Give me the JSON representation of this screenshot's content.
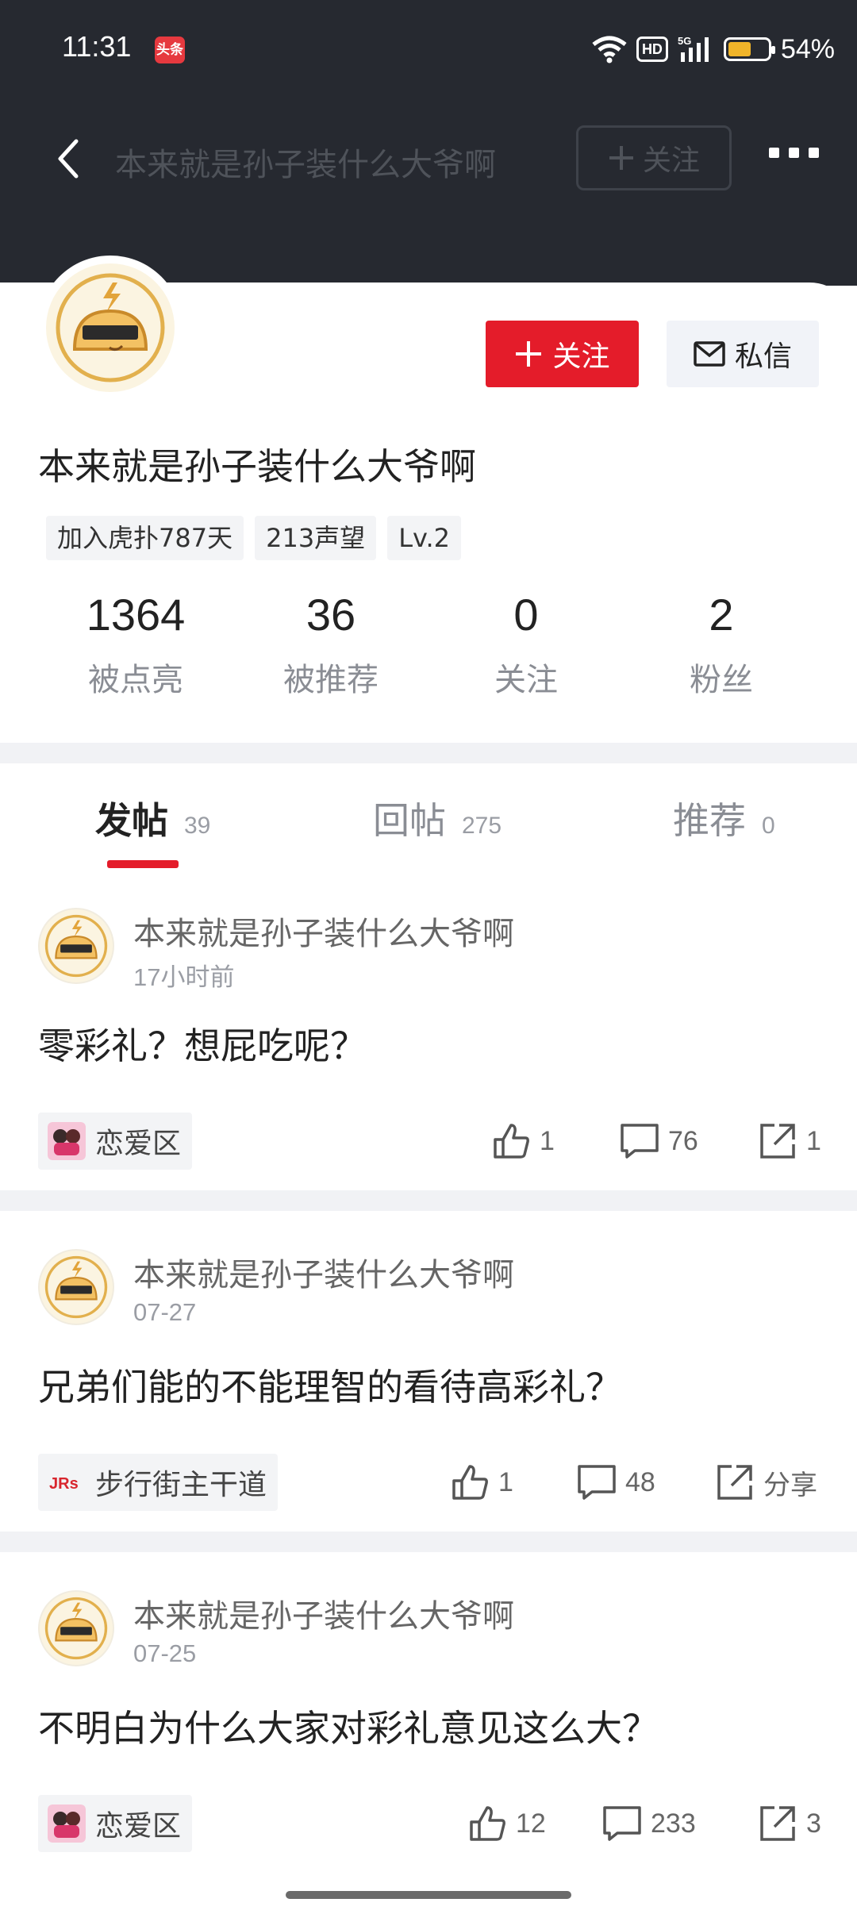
{
  "status_bar": {
    "time": "11:31",
    "app_badge": "头条",
    "network": "5G",
    "hd": "HD",
    "battery": "54%"
  },
  "nav": {
    "title": "本来就是孙子装什么大爷啊",
    "follow_label": "关注"
  },
  "profile": {
    "name": "本来就是孙子装什么大爷啊",
    "follow_button": "关注",
    "message_button": "私信",
    "tags": [
      "加入虎扑787天",
      "213声望",
      "Lv.2"
    ],
    "stats": [
      {
        "value": "1364",
        "label": "被点亮"
      },
      {
        "value": "36",
        "label": "被推荐"
      },
      {
        "value": "0",
        "label": "关注"
      },
      {
        "value": "2",
        "label": "粉丝"
      }
    ]
  },
  "tabs": [
    {
      "label": "发帖",
      "count": "39"
    },
    {
      "label": "回帖",
      "count": "275"
    },
    {
      "label": "推荐",
      "count": "0"
    }
  ],
  "posts": [
    {
      "author": "本来就是孙子装什么大爷啊",
      "time": "17小时前",
      "title": "零彩礼？想屁吃呢？",
      "forum": "恋爱区",
      "likes": "1",
      "comments": "76",
      "share": "1"
    },
    {
      "author": "本来就是孙子装什么大爷啊",
      "time": "07-27",
      "title": "兄弟们能的不能理智的看待高彩礼？",
      "forum": "步行街主干道",
      "likes": "1",
      "comments": "48",
      "share": "分享"
    },
    {
      "author": "本来就是孙子装什么大爷啊",
      "time": "07-25",
      "title": "不明白为什么大家对彩礼意见这么大？",
      "forum": "恋爱区",
      "likes": "12",
      "comments": "233",
      "share": "3"
    }
  ],
  "colors": {
    "accent": "#e41c2a",
    "header": "#262930"
  }
}
